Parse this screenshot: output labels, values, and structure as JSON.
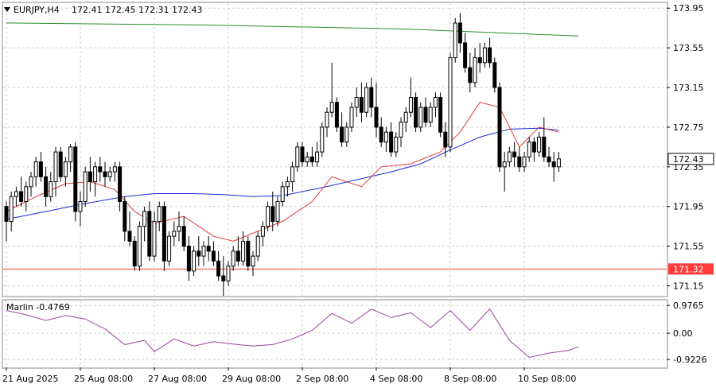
{
  "header": {
    "symbol": "EURJPY,H4",
    "ohlc": "172.41 172.45 172.31 172.43"
  },
  "indicator": {
    "label": "Marlin -0.4769",
    "ticks": [
      "0.9765",
      "0.00",
      "-0.9226"
    ],
    "ylim": [
      -1.2,
      1.15
    ]
  },
  "price_axis": {
    "ticks": [
      "173.95",
      "173.55",
      "173.15",
      "172.75",
      "172.35",
      "171.95",
      "171.55",
      "171.15"
    ],
    "current_price": "172.43",
    "support_label": "171.32"
  },
  "time_axis": {
    "labels": [
      "21 Aug 2025",
      "25 Aug 08:00",
      "27 Aug 08:00",
      "29 Aug 08:00",
      "2 Sep 08:00",
      "4 Sep 08:00",
      "8 Sep 08:00",
      "10 Sep 08:00"
    ]
  },
  "colors": {
    "support_line": "#ff3b3b",
    "ma_long": "#2e8b2e",
    "ma_mid": "#1a2ad6",
    "ma_short": "#e23a3a",
    "oscillator": "#a040a0",
    "bull_candle": "#ffffff",
    "bear_candle": "#000000"
  },
  "chart_data": {
    "type": "candlestick",
    "ylim": [
      171.05,
      174.0
    ],
    "grid": true,
    "support_level": 171.32,
    "last_price": 172.43,
    "candles": [
      [
        171.95,
        172.0,
        171.6,
        171.8
      ],
      [
        171.8,
        172.1,
        171.7,
        172.05
      ],
      [
        172.05,
        172.15,
        171.95,
        172.1
      ],
      [
        172.1,
        172.25,
        171.95,
        172.0
      ],
      [
        172.0,
        172.2,
        171.9,
        172.15
      ],
      [
        172.15,
        172.3,
        172.05,
        172.25
      ],
      [
        172.25,
        172.45,
        172.15,
        172.4
      ],
      [
        172.4,
        172.5,
        172.2,
        172.25
      ],
      [
        172.25,
        172.35,
        171.95,
        172.05
      ],
      [
        172.05,
        172.3,
        172.0,
        172.2
      ],
      [
        172.2,
        172.55,
        172.05,
        172.5
      ],
      [
        172.5,
        172.55,
        172.2,
        172.25
      ],
      [
        172.25,
        172.45,
        172.15,
        172.4
      ],
      [
        172.4,
        172.58,
        172.3,
        172.55
      ],
      [
        172.55,
        172.6,
        171.8,
        171.9
      ],
      [
        171.9,
        172.1,
        171.75,
        172.0
      ],
      [
        172.0,
        172.35,
        171.95,
        172.3
      ],
      [
        172.3,
        172.45,
        172.1,
        172.2
      ],
      [
        172.2,
        172.4,
        172.05,
        172.35
      ],
      [
        172.35,
        172.45,
        172.2,
        172.3
      ],
      [
        172.3,
        172.4,
        172.15,
        172.25
      ],
      [
        172.25,
        172.35,
        172.2,
        172.3
      ],
      [
        172.3,
        172.4,
        172.2,
        172.35
      ],
      [
        172.35,
        172.4,
        171.9,
        172.0
      ],
      [
        172.0,
        172.05,
        171.6,
        171.7
      ],
      [
        171.7,
        171.9,
        171.55,
        171.6
      ],
      [
        171.6,
        171.65,
        171.3,
        171.35
      ],
      [
        171.35,
        171.8,
        171.3,
        171.75
      ],
      [
        171.75,
        171.95,
        171.6,
        171.9
      ],
      [
        171.9,
        172.0,
        171.4,
        171.45
      ],
      [
        171.45,
        171.9,
        171.4,
        171.8
      ],
      [
        171.8,
        172.0,
        171.7,
        171.95
      ],
      [
        171.95,
        172.0,
        171.3,
        171.4
      ],
      [
        171.4,
        171.7,
        171.35,
        171.65
      ],
      [
        171.65,
        171.8,
        171.55,
        171.7
      ],
      [
        171.7,
        171.9,
        171.6,
        171.75
      ],
      [
        171.75,
        171.85,
        171.5,
        171.55
      ],
      [
        171.55,
        171.65,
        171.2,
        171.3
      ],
      [
        171.3,
        171.55,
        171.25,
        171.5
      ],
      [
        171.5,
        171.65,
        171.35,
        171.45
      ],
      [
        171.45,
        171.6,
        171.35,
        171.55
      ],
      [
        171.55,
        171.65,
        171.4,
        171.5
      ],
      [
        171.5,
        171.6,
        171.35,
        171.4
      ],
      [
        171.4,
        171.5,
        171.2,
        171.25
      ],
      [
        171.25,
        171.45,
        171.05,
        171.2
      ],
      [
        171.2,
        171.4,
        171.15,
        171.35
      ],
      [
        171.35,
        171.55,
        171.3,
        171.5
      ],
      [
        171.5,
        171.65,
        171.35,
        171.4
      ],
      [
        171.4,
        171.7,
        171.35,
        171.6
      ],
      [
        171.6,
        171.65,
        171.3,
        171.35
      ],
      [
        171.35,
        171.5,
        171.25,
        171.45
      ],
      [
        171.45,
        171.7,
        171.4,
        171.65
      ],
      [
        171.65,
        171.8,
        171.55,
        171.75
      ],
      [
        171.75,
        172.0,
        171.7,
        171.95
      ],
      [
        171.95,
        172.1,
        171.7,
        171.8
      ],
      [
        171.8,
        172.05,
        171.75,
        172.0
      ],
      [
        172.0,
        172.2,
        171.95,
        172.15
      ],
      [
        172.15,
        172.25,
        172.05,
        172.2
      ],
      [
        172.2,
        172.4,
        172.1,
        172.35
      ],
      [
        172.35,
        172.6,
        172.3,
        172.55
      ],
      [
        172.55,
        172.6,
        172.35,
        172.4
      ],
      [
        172.4,
        172.5,
        172.35,
        172.45
      ],
      [
        172.45,
        172.55,
        172.35,
        172.4
      ],
      [
        172.4,
        172.6,
        172.35,
        172.5
      ],
      [
        172.5,
        172.8,
        172.45,
        172.75
      ],
      [
        172.75,
        172.95,
        172.65,
        172.9
      ],
      [
        172.9,
        173.4,
        172.85,
        173.0
      ],
      [
        173.0,
        173.05,
        172.7,
        172.75
      ],
      [
        172.75,
        172.9,
        172.55,
        172.6
      ],
      [
        172.6,
        172.8,
        172.55,
        172.75
      ],
      [
        172.75,
        173.0,
        172.7,
        172.95
      ],
      [
        172.95,
        173.15,
        172.85,
        173.05
      ],
      [
        173.05,
        173.2,
        172.8,
        172.9
      ],
      [
        172.9,
        173.2,
        172.85,
        173.15
      ],
      [
        173.15,
        173.25,
        172.85,
        172.95
      ],
      [
        172.95,
        173.2,
        172.65,
        172.75
      ],
      [
        172.75,
        172.85,
        172.55,
        172.6
      ],
      [
        172.6,
        172.75,
        172.5,
        172.7
      ],
      [
        172.7,
        172.8,
        172.45,
        172.5
      ],
      [
        172.5,
        172.7,
        172.45,
        172.65
      ],
      [
        172.65,
        172.85,
        172.55,
        172.8
      ],
      [
        172.8,
        172.95,
        172.7,
        172.9
      ],
      [
        172.9,
        173.25,
        172.85,
        173.05
      ],
      [
        173.05,
        173.1,
        172.7,
        172.75
      ],
      [
        172.75,
        173.0,
        172.7,
        172.95
      ],
      [
        172.95,
        173.05,
        172.75,
        172.8
      ],
      [
        172.8,
        173.0,
        172.75,
        172.95
      ],
      [
        172.95,
        173.1,
        172.85,
        173.05
      ],
      [
        173.05,
        173.1,
        172.65,
        172.7
      ],
      [
        172.7,
        172.8,
        172.45,
        172.55
      ],
      [
        172.55,
        173.5,
        172.5,
        173.45
      ],
      [
        173.45,
        173.85,
        173.4,
        173.8
      ],
      [
        173.8,
        173.9,
        173.5,
        173.6
      ],
      [
        173.6,
        173.7,
        173.3,
        173.35
      ],
      [
        173.35,
        173.5,
        173.1,
        173.2
      ],
      [
        173.2,
        173.55,
        173.15,
        173.45
      ],
      [
        173.45,
        173.6,
        173.3,
        173.4
      ],
      [
        173.4,
        173.6,
        173.35,
        173.55
      ],
      [
        173.55,
        173.65,
        173.35,
        173.4
      ],
      [
        173.4,
        173.45,
        173.1,
        173.15
      ],
      [
        173.15,
        173.2,
        172.3,
        172.35
      ],
      [
        172.35,
        172.5,
        172.1,
        172.4
      ],
      [
        172.4,
        172.55,
        172.35,
        172.5
      ],
      [
        172.5,
        172.6,
        172.35,
        172.45
      ],
      [
        172.45,
        172.55,
        172.3,
        172.35
      ],
      [
        172.35,
        172.5,
        172.3,
        172.45
      ],
      [
        172.45,
        172.65,
        172.4,
        172.6
      ],
      [
        172.6,
        172.65,
        172.4,
        172.5
      ],
      [
        172.5,
        172.7,
        172.45,
        172.65
      ],
      [
        172.65,
        172.85,
        172.4,
        172.45
      ],
      [
        172.45,
        172.55,
        172.35,
        172.4
      ],
      [
        172.4,
        172.5,
        172.2,
        172.35
      ],
      [
        172.35,
        172.5,
        172.3,
        172.43
      ]
    ],
    "series": [
      {
        "type": "line",
        "values": [
          [
            0,
            173.8
          ],
          [
            40,
            173.78
          ],
          [
            80,
            173.74
          ],
          [
            116,
            173.67
          ]
        ]
      },
      {
        "type": "line",
        "values": [
          [
            0,
            171.82
          ],
          [
            8,
            171.9
          ],
          [
            16,
            171.98
          ],
          [
            24,
            172.05
          ],
          [
            30,
            172.08
          ],
          [
            38,
            172.08
          ],
          [
            44,
            172.07
          ],
          [
            50,
            172.05
          ],
          [
            56,
            172.06
          ],
          [
            64,
            172.14
          ],
          [
            72,
            172.23
          ],
          [
            78,
            172.3
          ],
          [
            84,
            172.38
          ],
          [
            90,
            172.52
          ],
          [
            96,
            172.65
          ],
          [
            102,
            172.73
          ],
          [
            108,
            172.74
          ],
          [
            112,
            172.72
          ]
        ]
      },
      {
        "type": "line",
        "values": [
          [
            0,
            171.9
          ],
          [
            6,
            172.05
          ],
          [
            12,
            172.18
          ],
          [
            17,
            172.2
          ],
          [
            22,
            172.12
          ],
          [
            26,
            171.9
          ],
          [
            30,
            171.78
          ],
          [
            36,
            171.85
          ],
          [
            42,
            171.65
          ],
          [
            46,
            171.6
          ],
          [
            52,
            171.72
          ],
          [
            56,
            171.8
          ],
          [
            62,
            172.0
          ],
          [
            66,
            172.25
          ],
          [
            72,
            172.15
          ],
          [
            76,
            172.35
          ],
          [
            82,
            172.38
          ],
          [
            88,
            172.5
          ],
          [
            92,
            172.7
          ],
          [
            96,
            173.0
          ],
          [
            100,
            172.95
          ],
          [
            104,
            172.55
          ],
          [
            108,
            172.75
          ],
          [
            112,
            172.7
          ]
        ]
      },
      {
        "type": "line",
        "values": [
          [
            0,
            0.8
          ],
          [
            4,
            0.65
          ],
          [
            8,
            0.45
          ],
          [
            12,
            0.62
          ],
          [
            16,
            0.5
          ],
          [
            20,
            0.15
          ],
          [
            24,
            -0.4
          ],
          [
            28,
            -0.25
          ],
          [
            30,
            -0.65
          ],
          [
            34,
            -0.2
          ],
          [
            38,
            -0.45
          ],
          [
            42,
            -0.3
          ],
          [
            46,
            -0.38
          ],
          [
            50,
            -0.45
          ],
          [
            54,
            -0.4
          ],
          [
            58,
            -0.2
          ],
          [
            62,
            0.1
          ],
          [
            66,
            0.7
          ],
          [
            70,
            0.35
          ],
          [
            74,
            0.85
          ],
          [
            78,
            0.55
          ],
          [
            82,
            0.72
          ],
          [
            86,
            0.2
          ],
          [
            90,
            0.8
          ],
          [
            94,
            0.1
          ],
          [
            98,
            0.85
          ],
          [
            102,
            -0.25
          ],
          [
            106,
            -0.85
          ],
          [
            110,
            -0.7
          ],
          [
            114,
            -0.6
          ],
          [
            116,
            -0.48
          ]
        ]
      }
    ]
  }
}
